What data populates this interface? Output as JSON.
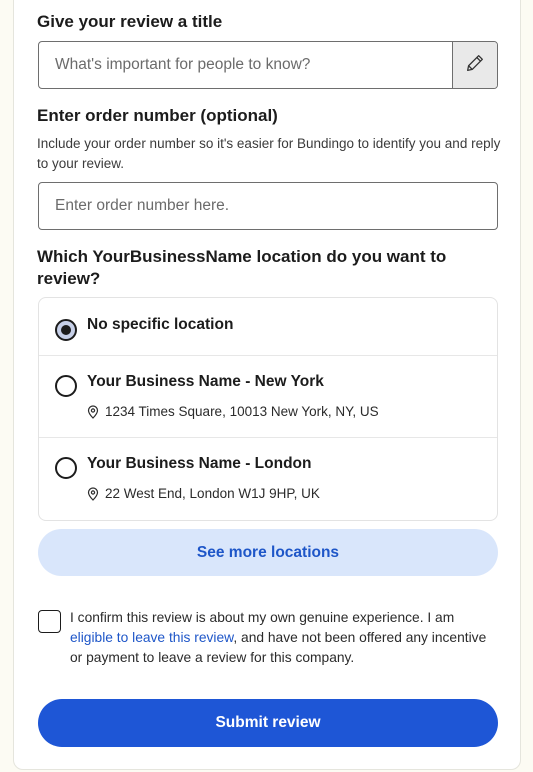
{
  "title_field": {
    "label": "Give your review a title",
    "placeholder": "What's important for people to know?",
    "value": "",
    "icon": "pencil-icon"
  },
  "order_field": {
    "label": "Enter order number (optional)",
    "help": "Include your order number so it's easier for Bundingo to identify you and reply to your review.",
    "placeholder": "Enter order number here.",
    "value": ""
  },
  "location": {
    "question": "Which YourBusinessName location do you want to review?",
    "options": [
      {
        "name": "No specific location",
        "address": "",
        "selected": true
      },
      {
        "name": "Your Business Name - New York",
        "address": "1234 Times Square, 10013 New York, NY, US",
        "selected": false
      },
      {
        "name": "Your Business Name - London",
        "address": "22 West End, London W1J 9HP, UK",
        "selected": false
      }
    ],
    "address_icon": "map-pin-icon",
    "see_more_label": "See more locations"
  },
  "confirm": {
    "text_before": "I confirm this review is about my own genuine experience. I am ",
    "link_text": "eligible to leave this review",
    "text_after": ", and have not been offered any incentive or payment to leave a review for this company.",
    "checked": false
  },
  "submit_label": "Submit review",
  "colors": {
    "accent": "#1e56d6",
    "accent_light": "#d9e6fb",
    "link": "#1e56c8",
    "page_bg": "#fcfbf3"
  }
}
